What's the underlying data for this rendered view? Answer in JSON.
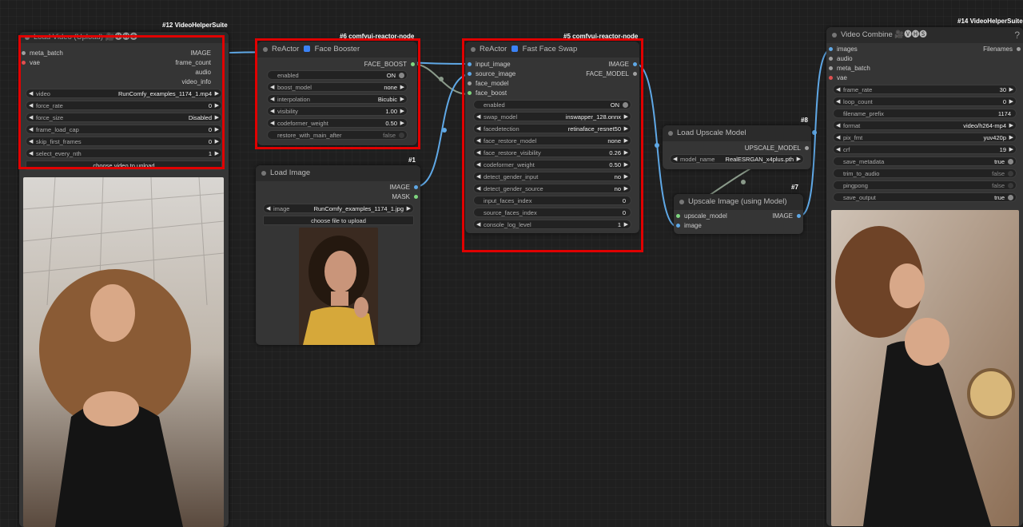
{
  "colors": {
    "image": "#5fa8e6",
    "vae": "#e05050",
    "other": "#a0a0a0",
    "face": "#7fd67f",
    "link_gray": "#8a9a8a",
    "highlight": "#e00000"
  },
  "node12": {
    "badge": "#12 VideoHelperSuite",
    "title": "Load Video (Upload) 🎥🅥🅗🅢",
    "inputs": [
      {
        "label": "meta_batch"
      },
      {
        "label": "vae"
      }
    ],
    "outputs": [
      {
        "label": "IMAGE"
      },
      {
        "label": "frame_count"
      },
      {
        "label": "audio"
      },
      {
        "label": "video_info"
      }
    ],
    "widgets": [
      {
        "label": "video",
        "value": "RunComfy_examples_1174_1.mp4"
      },
      {
        "label": "force_rate",
        "value": "0"
      },
      {
        "label": "force_size",
        "value": "Disabled"
      },
      {
        "label": "frame_load_cap",
        "value": "0"
      },
      {
        "label": "skip_first_frames",
        "value": "0"
      },
      {
        "label": "select_every_nth",
        "value": "1"
      }
    ],
    "upload_button": "choose video to upload"
  },
  "node6": {
    "badge": "#6 comfyui-reactor-node",
    "title_a": "ReActor",
    "title_b": "Face Booster",
    "outputs": [
      {
        "label": "FACE_BOOST"
      }
    ],
    "widgets": [
      {
        "label": "enabled",
        "value": "ON"
      },
      {
        "label": "boost_model",
        "value": "none"
      },
      {
        "label": "interpolation",
        "value": "Bicubic"
      },
      {
        "label": "visibility",
        "value": "1.00"
      },
      {
        "label": "codeformer_weight",
        "value": "0.50"
      },
      {
        "label": "restore_with_main_after",
        "value": "false"
      }
    ]
  },
  "node1": {
    "badge": "#1",
    "title": "Load Image",
    "outputs": [
      {
        "label": "IMAGE"
      },
      {
        "label": "MASK"
      }
    ],
    "widget": {
      "label": "image",
      "value": "RunComfy_examples_1174_1.jpg"
    },
    "upload_button": "choose file to upload"
  },
  "node5": {
    "badge": "#5 comfyui-reactor-node",
    "title_a": "ReActor",
    "title_b": "Fast Face Swap",
    "inputs": [
      {
        "label": "input_image"
      },
      {
        "label": "source_image"
      },
      {
        "label": "face_model"
      },
      {
        "label": "face_boost"
      }
    ],
    "outputs": [
      {
        "label": "IMAGE"
      },
      {
        "label": "FACE_MODEL"
      }
    ],
    "widgets": [
      {
        "label": "enabled",
        "value": "ON"
      },
      {
        "label": "swap_model",
        "value": "inswapper_128.onnx"
      },
      {
        "label": "facedetection",
        "value": "retinaface_resnet50"
      },
      {
        "label": "face_restore_model",
        "value": "none"
      },
      {
        "label": "face_restore_visibility",
        "value": "0.26"
      },
      {
        "label": "codeformer_weight",
        "value": "0.50"
      },
      {
        "label": "detect_gender_input",
        "value": "no"
      },
      {
        "label": "detect_gender_source",
        "value": "no"
      },
      {
        "label": "input_faces_index",
        "value": "0"
      },
      {
        "label": "source_faces_index",
        "value": "0"
      },
      {
        "label": "console_log_level",
        "value": "1"
      }
    ]
  },
  "node8": {
    "badge": "#8",
    "title": "Load Upscale Model",
    "outputs": [
      {
        "label": "UPSCALE_MODEL"
      }
    ],
    "widget": {
      "label": "model_name",
      "value": "RealESRGAN_x4plus.pth"
    }
  },
  "node7": {
    "badge": "#7",
    "title": "Upscale Image (using Model)",
    "inputs": [
      {
        "label": "upscale_model"
      },
      {
        "label": "image"
      }
    ],
    "outputs": [
      {
        "label": "IMAGE"
      }
    ]
  },
  "node14": {
    "badge": "#14 VideoHelperSuite",
    "title": "Video Combine 🎥🅥🅗🅢",
    "help": "?",
    "inputs": [
      {
        "label": "images"
      },
      {
        "label": "audio"
      },
      {
        "label": "meta_batch"
      },
      {
        "label": "vae"
      }
    ],
    "outputs": [
      {
        "label": "Filenames"
      }
    ],
    "widgets": [
      {
        "label": "frame_rate",
        "value": "30"
      },
      {
        "label": "loop_count",
        "value": "0"
      },
      {
        "label": "filename_prefix",
        "value": "1174"
      },
      {
        "label": "format",
        "value": "video/h264-mp4"
      },
      {
        "label": "pix_fmt",
        "value": "yuv420p"
      },
      {
        "label": "crf",
        "value": "19"
      },
      {
        "label": "save_metadata",
        "value": "true"
      },
      {
        "label": "trim_to_audio",
        "value": "false"
      },
      {
        "label": "pingpong",
        "value": "false"
      },
      {
        "label": "save_output",
        "value": "true"
      }
    ]
  }
}
